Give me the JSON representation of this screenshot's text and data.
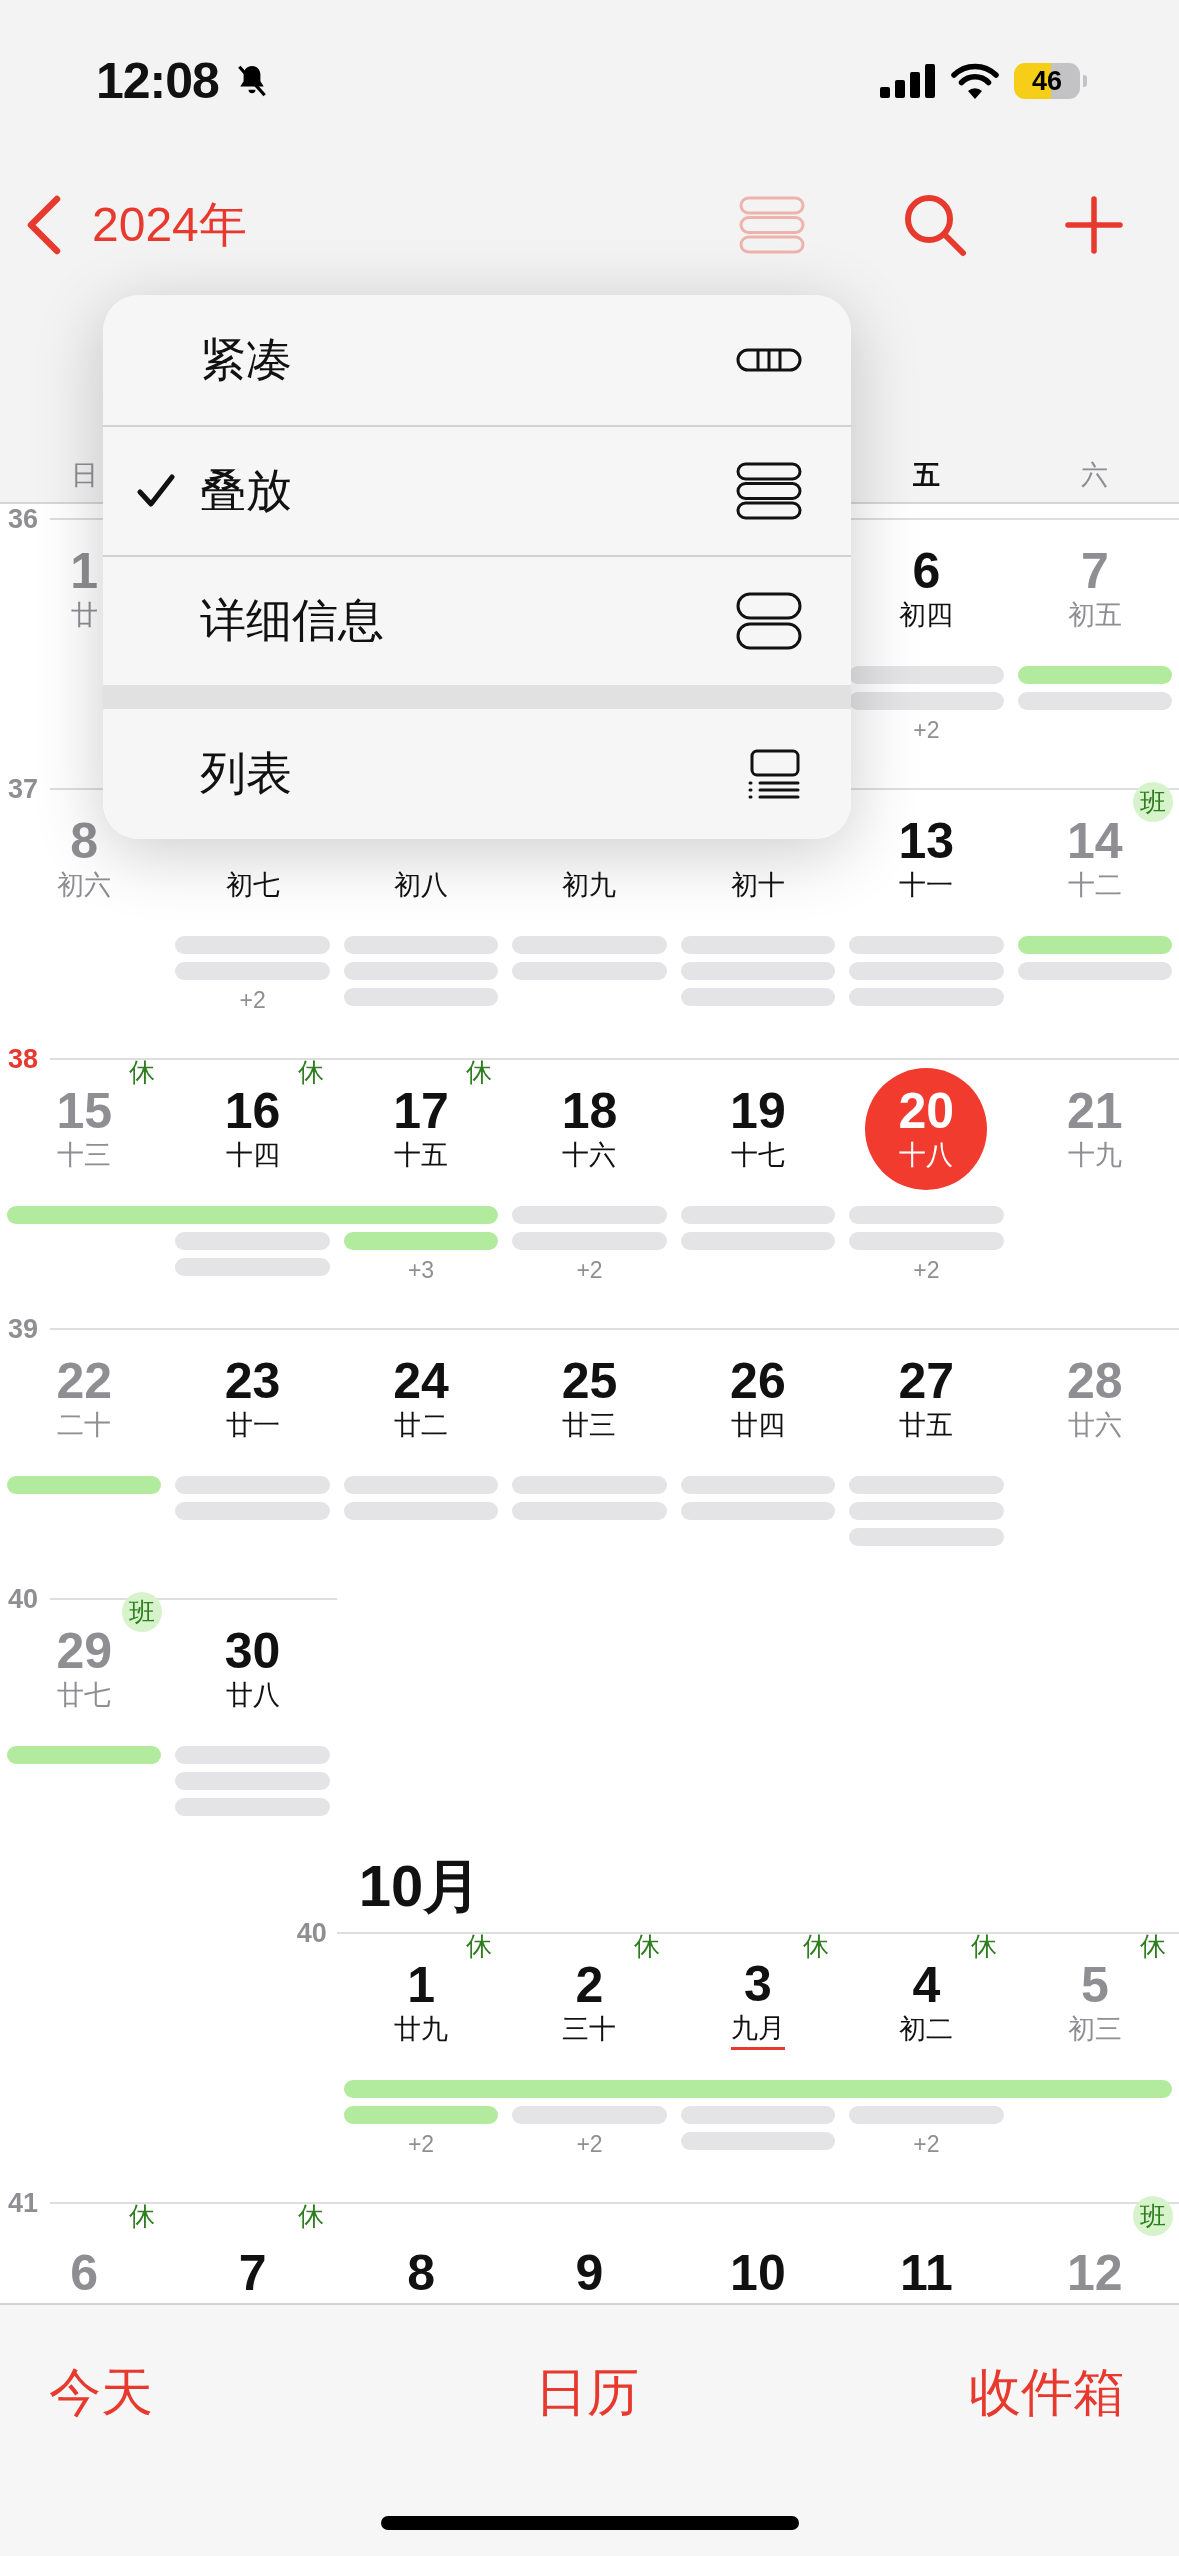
{
  "status_bar": {
    "time": "12:08",
    "battery": "46"
  },
  "nav": {
    "back": "2024年"
  },
  "weekdays": {
    "sun": {
      "label": "日",
      "weekend": true
    },
    "fri": {
      "label": "五",
      "weekend": false
    },
    "sat": {
      "label": "六",
      "weekend": true
    }
  },
  "months": [
    {
      "weeks": [
        {
          "number": "36",
          "current": false,
          "days": {
            "sun": {
              "date": "1",
              "lunar": "廿",
              "weekend": true,
              "today": false,
              "lunar_month_start": false
            },
            "fri": {
              "date": "6",
              "lunar": "初四",
              "weekend": false,
              "today": false,
              "lunar_month_start": false,
              "bars": [
                {
                  "kind": "event"
                },
                {
                  "kind": "event"
                }
              ],
              "more": "+2"
            },
            "sat": {
              "date": "7",
              "lunar": "初五",
              "weekend": true,
              "today": false,
              "lunar_month_start": false,
              "bars": [
                {
                  "kind": "holiday"
                },
                {
                  "kind": "event"
                }
              ]
            }
          }
        },
        {
          "number": "37",
          "current": false,
          "days": {
            "sun": {
              "date": "8",
              "lunar": "初六",
              "weekend": true,
              "today": false,
              "lunar_month_start": false
            },
            "mon": {
              "lunar": "初七",
              "weekend": false,
              "today": false,
              "lunar_month_start": false,
              "bars": [
                {
                  "kind": "event"
                },
                {
                  "kind": "event"
                }
              ],
              "more": "+2"
            },
            "tue": {
              "lunar": "初八",
              "weekend": false,
              "today": false,
              "lunar_month_start": false,
              "bars": [
                {
                  "kind": "event"
                },
                {
                  "kind": "event"
                },
                {
                  "kind": "event"
                }
              ]
            },
            "wed": {
              "lunar": "初九",
              "weekend": false,
              "today": false,
              "lunar_month_start": false,
              "bars": [
                {
                  "kind": "event"
                },
                {
                  "kind": "event"
                }
              ]
            },
            "thu": {
              "lunar": "初十",
              "weekend": false,
              "today": false,
              "lunar_month_start": false,
              "bars": [
                {
                  "kind": "event"
                },
                {
                  "kind": "event"
                },
                {
                  "kind": "event"
                }
              ]
            },
            "fri": {
              "date": "13",
              "lunar": "十一",
              "weekend": false,
              "today": false,
              "lunar_month_start": false,
              "bars": [
                {
                  "kind": "event"
                },
                {
                  "kind": "event"
                },
                {
                  "kind": "event"
                }
              ]
            },
            "sat": {
              "date": "14",
              "lunar": "十二",
              "weekend": true,
              "today": false,
              "lunar_month_start": false,
              "badge": {
                "text": "班",
                "kind": "work"
              },
              "bars": [
                {
                  "kind": "holiday"
                },
                {
                  "kind": "event"
                }
              ]
            }
          }
        },
        {
          "number": "38",
          "current": true,
          "days": {
            "sun": {
              "date": "15",
              "lunar": "十三",
              "weekend": true,
              "today": false,
              "lunar_month_start": false,
              "badge": {
                "text": "休",
                "kind": "rest"
              },
              "bars": [
                {
                  "kind": "holiday",
                  "span": true
                }
              ]
            },
            "mon": {
              "date": "16",
              "lunar": "十四",
              "weekend": false,
              "today": false,
              "lunar_month_start": false,
              "badge": {
                "text": "休",
                "kind": "rest"
              },
              "bars": [
                {
                  "kind": "holiday",
                  "span": true
                },
                {
                  "kind": "event"
                },
                {
                  "kind": "event"
                }
              ]
            },
            "tue": {
              "date": "17",
              "lunar": "十五",
              "weekend": false,
              "today": false,
              "lunar_month_start": false,
              "badge": {
                "text": "休",
                "kind": "rest"
              },
              "bars": [
                {
                  "kind": "holiday",
                  "span": true
                },
                {
                  "kind": "holiday"
                }
              ],
              "more": "+3"
            },
            "wed": {
              "date": "18",
              "lunar": "十六",
              "weekend": false,
              "today": false,
              "lunar_month_start": false,
              "bars": [
                {
                  "kind": "event"
                },
                {
                  "kind": "event"
                }
              ],
              "more": "+2"
            },
            "thu": {
              "date": "19",
              "lunar": "十七",
              "weekend": false,
              "today": false,
              "lunar_month_start": false,
              "bars": [
                {
                  "kind": "event"
                },
                {
                  "kind": "event"
                }
              ]
            },
            "fri": {
              "date": "20",
              "lunar": "十八",
              "weekend": false,
              "today": true,
              "lunar_month_start": false,
              "bars": [
                {
                  "kind": "event"
                },
                {
                  "kind": "event"
                }
              ],
              "more": "+2"
            },
            "sat": {
              "date": "21",
              "lunar": "十九",
              "weekend": true,
              "today": false,
              "lunar_month_start": false
            }
          }
        },
        {
          "number": "39",
          "current": false,
          "days": {
            "sun": {
              "date": "22",
              "lunar": "二十",
              "weekend": true,
              "today": false,
              "lunar_month_start": false,
              "bars": [
                {
                  "kind": "holiday"
                }
              ]
            },
            "mon": {
              "date": "23",
              "lunar": "廿一",
              "weekend": false,
              "today": false,
              "lunar_month_start": false,
              "bars": [
                {
                  "kind": "event"
                },
                {
                  "kind": "event"
                }
              ]
            },
            "tue": {
              "date": "24",
              "lunar": "廿二",
              "weekend": false,
              "today": false,
              "lunar_month_start": false,
              "bars": [
                {
                  "kind": "event"
                },
                {
                  "kind": "event"
                }
              ]
            },
            "wed": {
              "date": "25",
              "lunar": "廿三",
              "weekend": false,
              "today": false,
              "lunar_month_start": false,
              "bars": [
                {
                  "kind": "event"
                },
                {
                  "kind": "event"
                }
              ]
            },
            "thu": {
              "date": "26",
              "lunar": "廿四",
              "weekend": false,
              "today": false,
              "lunar_month_start": false,
              "bars": [
                {
                  "kind": "event"
                },
                {
                  "kind": "event"
                }
              ]
            },
            "fri": {
              "date": "27",
              "lunar": "廿五",
              "weekend": false,
              "today": false,
              "lunar_month_start": false,
              "bars": [
                {
                  "kind": "event"
                },
                {
                  "kind": "event"
                },
                {
                  "kind": "event"
                }
              ]
            },
            "sat": {
              "date": "28",
              "lunar": "廿六",
              "weekend": true,
              "today": false,
              "lunar_month_start": false
            }
          }
        },
        {
          "number": "40",
          "current": false,
          "days": {
            "sun": {
              "date": "29",
              "lunar": "廿七",
              "weekend": true,
              "today": false,
              "lunar_month_start": false,
              "badge": {
                "text": "班",
                "kind": "work"
              },
              "bars": [
                {
                  "kind": "holiday"
                }
              ]
            },
            "mon": {
              "date": "30",
              "lunar": "廿八",
              "weekend": false,
              "today": false,
              "lunar_month_start": false,
              "bars": [
                {
                  "kind": "event"
                },
                {
                  "kind": "event"
                },
                {
                  "kind": "event"
                }
              ]
            }
          }
        }
      ]
    },
    {
      "title": "10月",
      "weeks": [
        {
          "number": "40",
          "current": false,
          "days": {
            "tue": {
              "date": "1",
              "lunar": "廿九",
              "weekend": false,
              "today": false,
              "lunar_month_start": false,
              "badge": {
                "text": "休",
                "kind": "rest"
              },
              "bars": [
                {
                  "kind": "holiday",
                  "span": true
                },
                {
                  "kind": "holiday"
                }
              ],
              "more": "+2"
            },
            "wed": {
              "date": "2",
              "lunar": "三十",
              "weekend": false,
              "today": false,
              "lunar_month_start": false,
              "badge": {
                "text": "休",
                "kind": "rest"
              },
              "bars": [
                {
                  "kind": "holiday",
                  "span": true
                },
                {
                  "kind": "event"
                }
              ],
              "more": "+2"
            },
            "thu": {
              "date": "3",
              "lunar": "九月",
              "weekend": false,
              "today": false,
              "lunar_month_start": true,
              "badge": {
                "text": "休",
                "kind": "rest"
              },
              "bars": [
                {
                  "kind": "holiday",
                  "span": true
                },
                {
                  "kind": "event"
                },
                {
                  "kind": "event"
                }
              ]
            },
            "fri": {
              "date": "4",
              "lunar": "初二",
              "weekend": false,
              "today": false,
              "lunar_month_start": false,
              "badge": {
                "text": "休",
                "kind": "rest"
              },
              "bars": [
                {
                  "kind": "holiday",
                  "span": true
                },
                {
                  "kind": "event"
                }
              ],
              "more": "+2"
            },
            "sat": {
              "date": "5",
              "lunar": "初三",
              "weekend": true,
              "today": false,
              "lunar_month_start": false,
              "badge": {
                "text": "休",
                "kind": "rest"
              },
              "bars": [
                {
                  "kind": "holiday",
                  "span": true
                }
              ]
            }
          }
        },
        {
          "number": "41",
          "current": false,
          "days": {
            "sun": {
              "date": "6",
              "weekend": true,
              "today": false,
              "badge": {
                "text": "休",
                "kind": "rest"
              }
            },
            "mon": {
              "date": "7",
              "weekend": false,
              "today": false,
              "badge": {
                "text": "休",
                "kind": "rest"
              }
            },
            "tue": {
              "date": "8",
              "weekend": false,
              "today": false
            },
            "wed": {
              "date": "9",
              "weekend": false,
              "today": false
            },
            "thu": {
              "date": "10",
              "weekend": false,
              "today": false
            },
            "fri": {
              "date": "11",
              "weekend": false,
              "today": false
            },
            "sat": {
              "date": "12",
              "weekend": true,
              "today": false,
              "badge": {
                "text": "班",
                "kind": "work"
              }
            }
          }
        }
      ]
    }
  ],
  "menu": {
    "groups": [
      [
        {
          "label": "紧凑",
          "kind": "compact",
          "selected": false
        },
        {
          "label": "叠放",
          "kind": "stacked",
          "selected": true
        },
        {
          "label": "详细信息",
          "kind": "details",
          "selected": false
        }
      ],
      [
        {
          "label": "列表",
          "kind": "list",
          "selected": false
        }
      ]
    ]
  },
  "tabs": [
    "今天",
    "日历",
    "收件箱"
  ]
}
